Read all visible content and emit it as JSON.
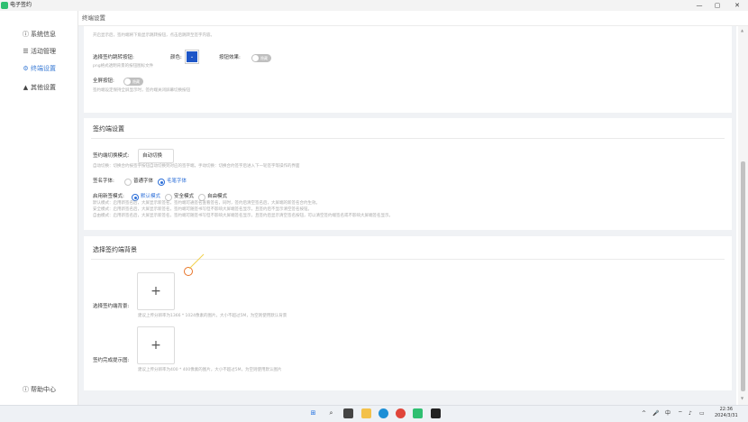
{
  "app": {
    "title": "电子签约"
  },
  "window_controls": {
    "minimize": "—",
    "maximize": "▢",
    "close": "✕"
  },
  "sidebar": {
    "items": [
      {
        "icon": "ⓘ",
        "icon_name": "info-icon",
        "label": "系统信息",
        "active": false
      },
      {
        "icon": "☰",
        "icon_name": "list-icon",
        "label": "活动管理",
        "active": false
      },
      {
        "icon": "⚙",
        "icon_name": "gear-icon",
        "label": "终端设置",
        "active": true
      },
      {
        "icon": "▲",
        "icon_name": "warning-icon",
        "label": "其他设置",
        "active": false
      }
    ],
    "help": {
      "icon": "ⓘ",
      "label": "帮助中心"
    }
  },
  "header": {
    "title": "终端设置"
  },
  "card1": {
    "top_hint": "开启显示后，签约端将下角显示跳转按钮，点击后跳转至签字内容。",
    "button_label": "选择签约跳转按钮:",
    "color_label": "颜色:",
    "color_value": "#1e56c7",
    "shadow_label": "按钮效果:",
    "shadow_toggle": "隐藏",
    "button_hint": "png格式透明背景的按钮图标文件",
    "fullscreen_label": "全屏按钮:",
    "fullscreen_toggle": "隐藏",
    "fullscreen_hint": "签约端设定保持全屏显示时，签约端关闭屏幕切换按钮"
  },
  "card2": {
    "section_title": "签约端设置",
    "mode_label": "签约端切换模式:",
    "mode_value": "自动切换",
    "mode_hint": "自动切换：切换合约按签字按钮自动切换到对应的签字端，手动切换：切换合约签字后进入下一轮签字等操作的界面",
    "font_label": "签名字体:",
    "font_options": [
      {
        "label": "普通字体",
        "selected": false
      },
      {
        "label": "毛笔字体",
        "selected": true
      }
    ],
    "display_label": "启用新签模式:",
    "display_options": [
      {
        "label": "默认模式",
        "selected": true
      },
      {
        "label": "安全模式",
        "selected": false
      },
      {
        "label": "自由模式",
        "selected": false
      }
    ],
    "desc_lines": [
      "默认模式：启用新签名后，大屏显示新签名，签约端可通签名查看签名，同时，签约后清空签名后，大屏端的新签名合约生效。",
      "安全模式：启用新签名后，大屏显示新签名，签约端可随签书写但不影响大屏端签名显示，且签约后不显示清空签名按钮。",
      "自由模式：启用新签名后，大屏显示新签名，签约端可随签书写但不影响大屏端签名显示，且签约后显示清空签名按钮，可以清空签约端签名或不影响大屏端签名显示。"
    ]
  },
  "card3": {
    "section_title": "选择签约端背景",
    "bg_label": "选择签约端背景:",
    "bg_plus": "+",
    "bg_hint": "建议上传分辨率为1366 * 1024像素的图片，大小不超过5M，为空则使用默认背景",
    "done_label": "签约完成提示图:",
    "done_plus": "+",
    "done_hint": "建议上传分辨率为400 * 400像素的图片，大小不超过5M，为空则使用默认图片"
  },
  "scrollbar": {
    "up": "▲",
    "down": "▼"
  },
  "taskbar": {
    "icons": [
      "windows-icon",
      "search-icon",
      "taskview-icon",
      "explorer-icon",
      "edge-icon",
      "chrome-icon",
      "app-icon",
      "terminal-icon"
    ],
    "tray_chevron": "^",
    "ime": "中",
    "time": "22:36",
    "date": "2024/3/31"
  }
}
